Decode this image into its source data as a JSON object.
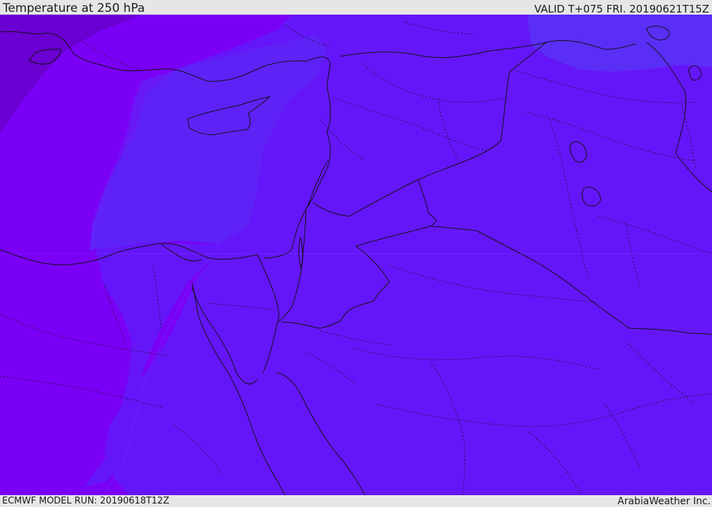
{
  "header": {
    "title": "Temperature at 250 hPa",
    "valid": "VALID T+075 FRI. 20190621T15Z"
  },
  "footer": {
    "model_run": "ECMWF MODEL RUN: 20190618T12Z",
    "credit": "ArabiaWeather Inc."
  },
  "map": {
    "colors": {
      "field_dark": "#6a00d1",
      "field_violet": "#7a00f5",
      "field_blue_violet": "#6516f8",
      "field_blue": "#5a2ef5",
      "border": "#111111"
    },
    "layers": {
      "temperature_fill": true,
      "coastlines": true,
      "country_borders": true,
      "province_borders": true
    }
  }
}
